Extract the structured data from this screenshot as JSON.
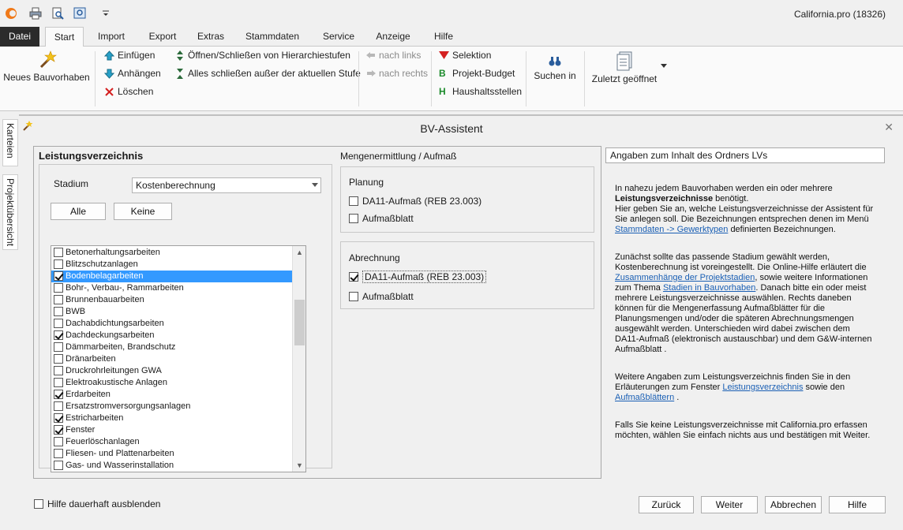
{
  "app": {
    "title": "California.pro (18326)"
  },
  "menu": {
    "tabs": [
      {
        "label": "Datei"
      },
      {
        "label": "Start"
      },
      {
        "label": "Import"
      },
      {
        "label": "Export"
      },
      {
        "label": "Extras"
      },
      {
        "label": "Stammdaten"
      },
      {
        "label": "Service"
      },
      {
        "label": "Anzeige"
      },
      {
        "label": "Hilfe"
      }
    ]
  },
  "ribbon": {
    "new_project": "Neues Bauvorhaben",
    "insert": "Einfügen",
    "append": "Anhängen",
    "delete": "Löschen",
    "toggle_hierarchy": "Öffnen/Schließen von Hierarchiestufen",
    "close_all_except": "Alles schließen außer der aktuellen Stufe",
    "move_left": "nach links",
    "move_right": "nach rechts",
    "selection": "Selektion",
    "project_budget": "Projekt-Budget",
    "budget_items": "Haushaltsstellen",
    "search_in": "Suchen in",
    "recently_opened": "Zuletzt geöffnet"
  },
  "side_tabs": {
    "cards": "Karteien",
    "project_overview": "Projektübersicht"
  },
  "dialog": {
    "title": "BV-Assistent",
    "section_title": "Leistungsverzeichnis",
    "stage_label": "Stadium",
    "stage_value": "Kostenberechnung",
    "all_button": "Alle",
    "none_button": "Keine",
    "trades": [
      {
        "label": "Betonerhaltungsarbeiten",
        "checked": false
      },
      {
        "label": "Blitzschutzanlagen",
        "checked": false
      },
      {
        "label": "Bodenbelagarbeiten",
        "checked": true,
        "selected": true
      },
      {
        "label": "Bohr-, Verbau-, Rammarbeiten",
        "checked": false
      },
      {
        "label": "Brunnenbauarbeiten",
        "checked": false
      },
      {
        "label": "BWB",
        "checked": false
      },
      {
        "label": "Dachabdichtungsarbeiten",
        "checked": false
      },
      {
        "label": "Dachdeckungsarbeiten",
        "checked": true
      },
      {
        "label": "Dämmarbeiten, Brandschutz",
        "checked": false
      },
      {
        "label": "Dränarbeiten",
        "checked": false
      },
      {
        "label": "Druckrohrleitungen GWA",
        "checked": false
      },
      {
        "label": "Elektroakustische Anlagen",
        "checked": false
      },
      {
        "label": "Erdarbeiten",
        "checked": true
      },
      {
        "label": "Ersatzstromversorgungsanlagen",
        "checked": false
      },
      {
        "label": "Estricharbeiten",
        "checked": true
      },
      {
        "label": "Fenster",
        "checked": true
      },
      {
        "label": "Feuerlöschanlagen",
        "checked": false
      },
      {
        "label": "Fliesen- und Plattenarbeiten",
        "checked": false
      },
      {
        "label": "Gas- und Wasserinstallation",
        "checked": false
      }
    ],
    "quantity_title": "Mengenermittlung / Aufmaß",
    "planning": {
      "title": "Planung",
      "options": [
        {
          "label": "DA11-Aufmaß (REB 23.003)",
          "checked": false
        },
        {
          "label": "Aufmaßblatt",
          "checked": false
        }
      ]
    },
    "billing": {
      "title": "Abrechnung",
      "options": [
        {
          "label": "DA11-Aufmaß (REB 23.003)",
          "checked": true
        },
        {
          "label": "Aufmaßblatt",
          "checked": false
        }
      ]
    },
    "help": {
      "heading": "Angaben zum Inhalt des Ordners LVs",
      "p1a": "In nahezu jedem Bauvorhaben werden ein oder mehrere",
      "p1b": "Leistungsverzeichnisse",
      "p1c": "benötigt.",
      "p1d": "Hier geben Sie an, welche Leistungsverzeichnisse der Assistent für Sie anlegen soll. Die Bezeichnungen entsprechen denen im Menü",
      "p1link": "Stammdaten -> Gewerktypen",
      "p1e": "definierten Bezeichnungen.",
      "p2a": "Zunächst sollte das passende Stadium gewählt werden, Kostenberechnung ist voreingestellt. Die Online-Hilfe erläutert die",
      "p2link1": "Zusammenhänge der Projektstadien",
      "p2b": ", sowie weitere Informationen zum Thema",
      "p2link2": "Stadien in Bauvorhaben",
      "p2c": ". Danach bitte ein oder meist mehrere Leistungsverzeichnisse auswählen. Rechts daneben können für die Mengenerfassung Aufmaßblätter  für die Planungsmengen und/oder die späteren Abrechnungsmengen ausgewählt werden. Unterschieden wird dabei zwischen dem DA11-Aufmaß (elektronisch austauschbar) und dem G&W-internen  Aufmaßblatt .",
      "p3a": "Weitere Angaben zum Leistungsverzeichnis finden Sie in den Erläuterungen zum Fenster",
      "p3link1": "Leistungsverzeichnis",
      "p3b": "sowie den",
      "p3link2": "Aufmaßblättern",
      "p3c": ".",
      "p4": "Falls Sie keine Leistungsverzeichnisse mit California.pro erfassen möchten, wählen Sie einfach nichts aus und bestätigen mit Weiter."
    },
    "hide_help": "Hilfe dauerhaft ausblenden",
    "back": "Zurück",
    "next": "Weiter",
    "cancel": "Abbrechen",
    "help_button": "Hilfe"
  }
}
